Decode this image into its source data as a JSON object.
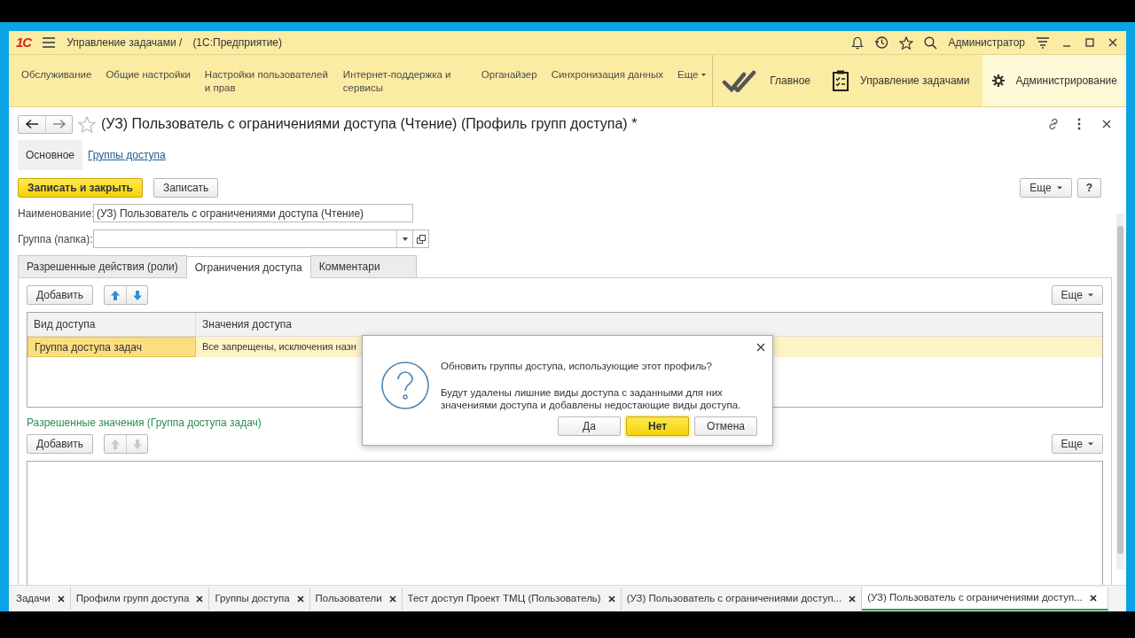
{
  "app": {
    "logo": "1С",
    "title": "Управление задачами /",
    "subtitle": "(1С:Предприятие)",
    "user": "Администратор"
  },
  "section_links": [
    {
      "label": "Обслуживание"
    },
    {
      "label": "Общие настройки"
    },
    {
      "label": "Настройки пользователей и прав"
    },
    {
      "label": "Интернет-поддержка и сервисы"
    },
    {
      "label": "Органайзер"
    },
    {
      "label": "Синхронизация данных"
    }
  ],
  "section_more": "Еще",
  "sections": [
    {
      "label": "Главное",
      "selected": false
    },
    {
      "label": "Управление задачами",
      "selected": false
    },
    {
      "label": "Администрирование",
      "selected": true
    }
  ],
  "form": {
    "title": "(УЗ) Пользователь с ограничениями доступа (Чтение) (Профиль групп доступа) *",
    "nav": [
      {
        "label": "Основное",
        "selected": true
      },
      {
        "label": "Группы доступа",
        "selected": false
      }
    ],
    "buttons": [
      {
        "label": "Записать и закрыть",
        "kind": "primary"
      },
      {
        "label": "Записать",
        "kind": "plain"
      }
    ],
    "more": "Еще",
    "help": "?",
    "fields": [
      {
        "label": "Наименование:",
        "value": "(УЗ) Пользователь с ограничениями доступа (Чтение)",
        "kind": "text"
      },
      {
        "label": "Группа (папка):",
        "kind": "choice"
      }
    ],
    "tabs": [
      {
        "label": "Разрешенные действия (роли)",
        "selected": false
      },
      {
        "label": "Ограничения доступа",
        "selected": true
      },
      {
        "label": "Комментари",
        "selected": false
      }
    ],
    "kinds_table": {
      "add": "Добавить",
      "more": "Еще",
      "arrows_disabled": false,
      "columns": [
        "Вид доступа",
        "Значения доступа"
      ],
      "rows": [
        {
          "cells": [
            "Группа доступа задач",
            "Все запрещены, исключения назн"
          ],
          "selected": true
        }
      ]
    },
    "values_caption": "Разрешенные значения (Группа доступа задач)",
    "values_table": {
      "add": "Добавить",
      "more": "Еще",
      "arrows_disabled": true
    }
  },
  "dialog": {
    "question": "Обновить группы доступа, использующие этот профиль?",
    "message": "Будут удалены лишние виды доступа с заданными для них значениями доступа и добавлены недостающие виды доступа.",
    "buttons": [
      {
        "label": "Да",
        "default": false
      },
      {
        "label": "Нет",
        "default": true
      },
      {
        "label": "Отмена",
        "default": false
      }
    ]
  },
  "window_tabs": [
    {
      "label": "Задачи",
      "selected": false
    },
    {
      "label": "Профили групп доступа",
      "selected": false
    },
    {
      "label": "Группы доступа",
      "selected": false
    },
    {
      "label": "Пользователи",
      "selected": false
    },
    {
      "label": "Тест доступ Проект ТМЦ (Пользователь)",
      "selected": false
    },
    {
      "label": "(УЗ) Пользователь с ограничениями доступ...",
      "selected": false
    },
    {
      "label": "(УЗ) Пользователь с ограничениями доступ...",
      "selected": true
    }
  ]
}
